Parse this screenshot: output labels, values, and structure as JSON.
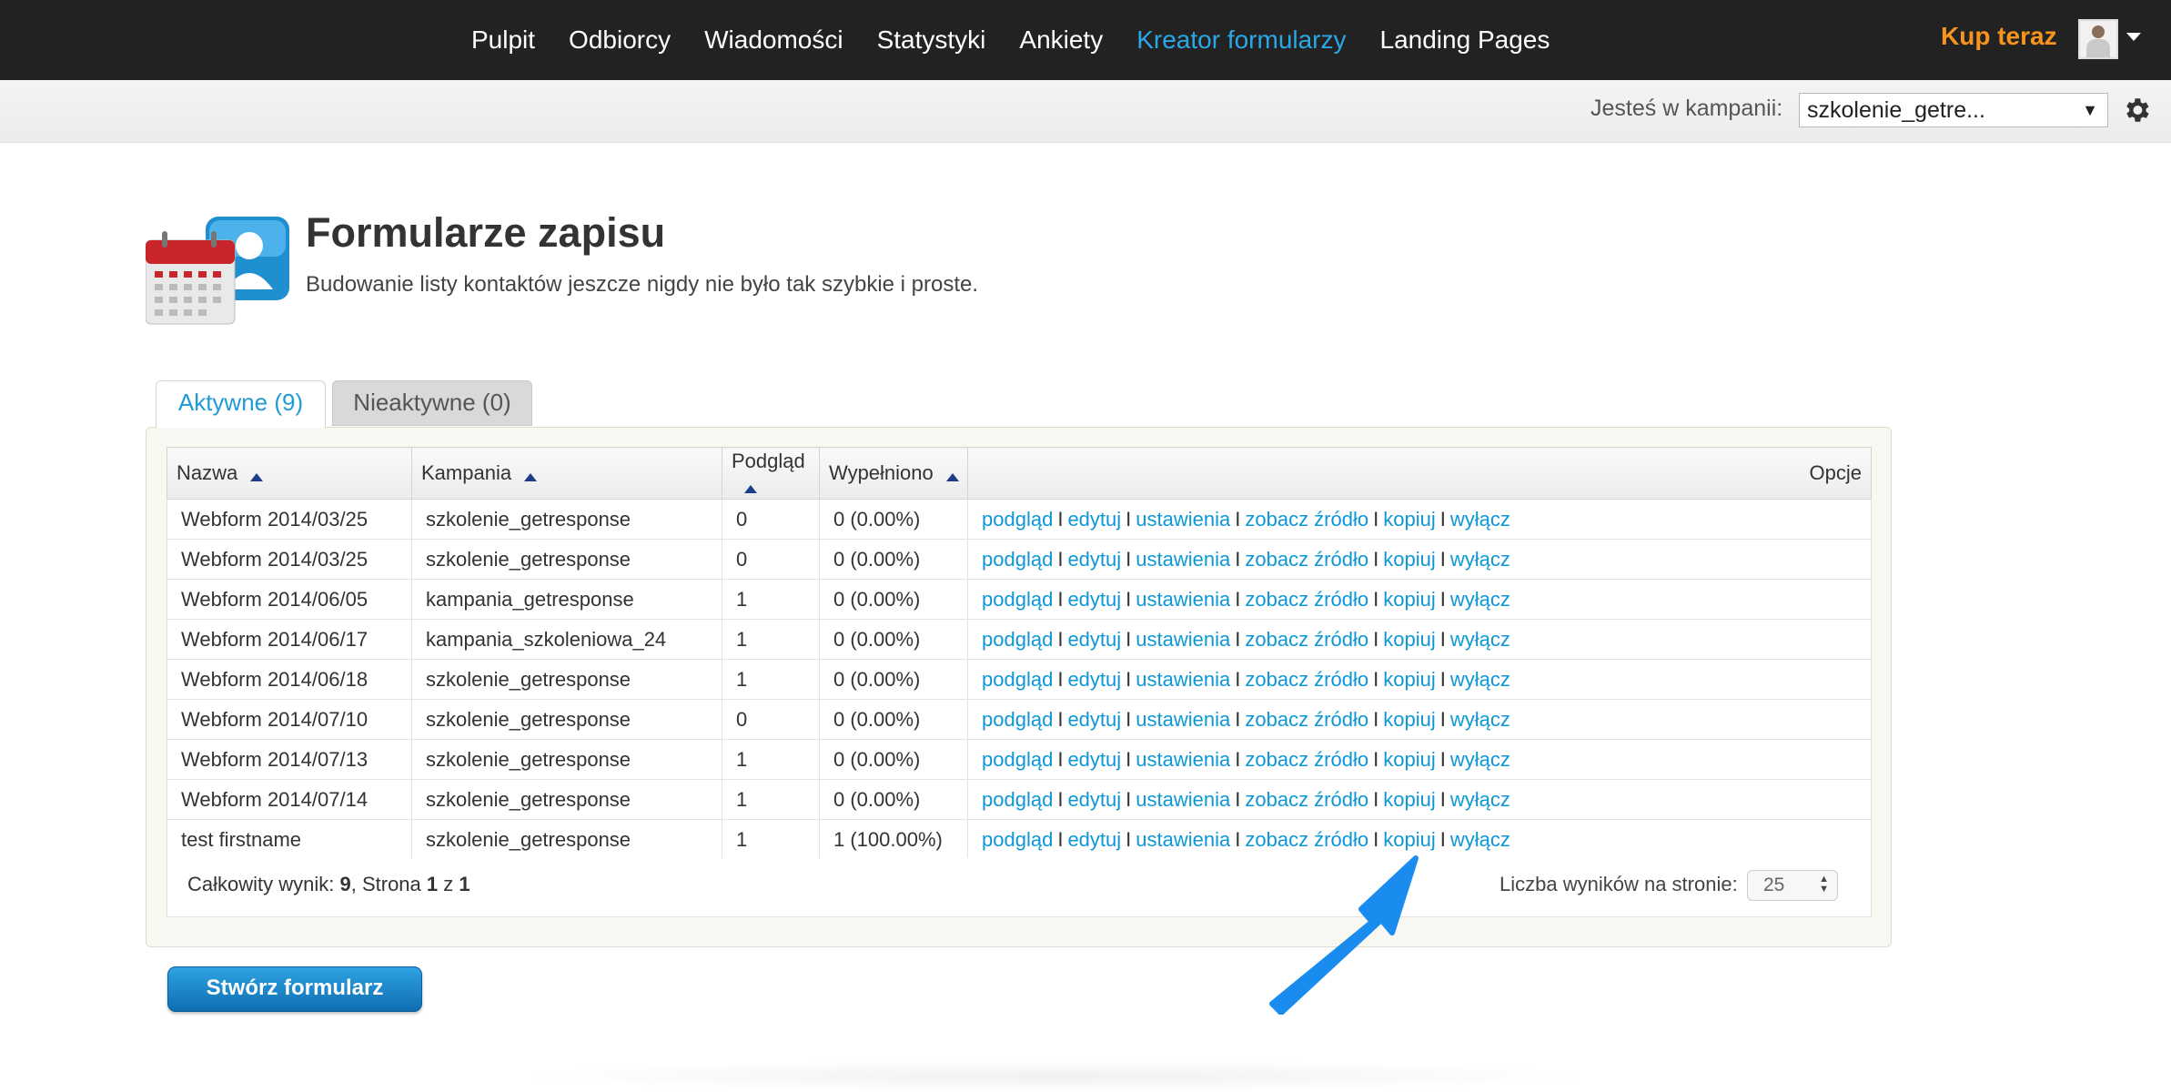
{
  "nav": {
    "items": [
      {
        "label": "Pulpit",
        "active": false
      },
      {
        "label": "Odbiorcy",
        "active": false
      },
      {
        "label": "Wiadomości",
        "active": false
      },
      {
        "label": "Statystyki",
        "active": false
      },
      {
        "label": "Ankiety",
        "active": false
      },
      {
        "label": "Kreator formularzy",
        "active": true
      },
      {
        "label": "Landing Pages",
        "active": false
      }
    ],
    "buy_label": "Kup teraz",
    "accent_color": "#2aa8e6",
    "buy_color": "#f7941d"
  },
  "campaign": {
    "label": "Jesteś w kampanii:",
    "selected": "szkolenie_getre..."
  },
  "page": {
    "title": "Formularze zapisu",
    "subtitle": "Budowanie listy kontaktów jeszcze nigdy nie było tak szybkie i proste."
  },
  "tabs": [
    {
      "label": "Aktywne (9)",
      "active": true
    },
    {
      "label": "Nieaktywne (0)",
      "active": false
    }
  ],
  "table": {
    "columns": [
      "Nazwa",
      "Kampania",
      "Podgląd",
      "Wypełniono",
      "Opcje"
    ],
    "actions": [
      "podgląd",
      "edytuj",
      "ustawienia",
      "zobacz źródło",
      "kopiuj",
      "wyłącz"
    ],
    "action_separator": "I",
    "rows": [
      {
        "name": "Webform 2014/03/25",
        "campaign": "szkolenie_getresponse",
        "preview": "0",
        "filled": "0 (0.00%)"
      },
      {
        "name": "Webform 2014/03/25",
        "campaign": "szkolenie_getresponse",
        "preview": "0",
        "filled": "0 (0.00%)"
      },
      {
        "name": "Webform 2014/06/05",
        "campaign": "kampania_getresponse",
        "preview": "1",
        "filled": "0 (0.00%)"
      },
      {
        "name": "Webform 2014/06/17",
        "campaign": "kampania_szkoleniowa_24",
        "preview": "1",
        "filled": "0 (0.00%)"
      },
      {
        "name": "Webform 2014/06/18",
        "campaign": "szkolenie_getresponse",
        "preview": "1",
        "filled": "0 (0.00%)"
      },
      {
        "name": "Webform 2014/07/10",
        "campaign": "szkolenie_getresponse",
        "preview": "0",
        "filled": "0 (0.00%)"
      },
      {
        "name": "Webform 2014/07/13",
        "campaign": "szkolenie_getresponse",
        "preview": "1",
        "filled": "0 (0.00%)"
      },
      {
        "name": "Webform 2014/07/14",
        "campaign": "szkolenie_getresponse",
        "preview": "1",
        "filled": "0 (0.00%)"
      },
      {
        "name": "test firstname",
        "campaign": "szkolenie_getresponse",
        "preview": "1",
        "filled": "1 (100.00%)"
      }
    ],
    "footer": {
      "total_prefix": "Całkowity wynik: ",
      "total": "9",
      "page_prefix": ", Strona ",
      "page": "1",
      "of": " z ",
      "pages": "1",
      "per_page_label": "Liczba wyników na stronie:",
      "per_page": "25"
    }
  },
  "create_button": "Stwórz formularz",
  "icons": [
    "calendar-user-icon",
    "gear-icon",
    "avatar",
    "annotation-arrow-icon"
  ]
}
